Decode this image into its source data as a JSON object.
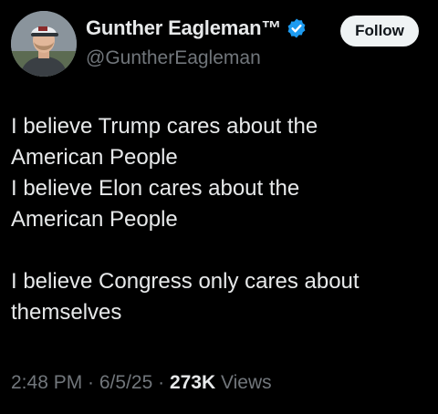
{
  "author": {
    "display_name": "Gunther Eagleman™",
    "handle": "@GuntherEagleman",
    "avatar_icon": "profile-photo",
    "verified_icon": "verified-badge-icon",
    "verified_color": "#1d9bf0"
  },
  "follow_button": {
    "label": "Follow"
  },
  "tweet_text": {
    "lines": [
      "I believe Trump cares about the",
      "American People",
      "I believe Elon cares about the",
      "American People",
      "",
      "I believe Congress only cares about",
      "themselves"
    ]
  },
  "meta": {
    "time": "2:48 PM",
    "separator": "·",
    "date": "6/5/25",
    "views_count": "273K",
    "views_label": "Views"
  },
  "colors": {
    "background": "#000000",
    "primary_text": "#e7e9ea",
    "secondary_text": "#71767b",
    "follow_bg": "#eff3f4"
  }
}
